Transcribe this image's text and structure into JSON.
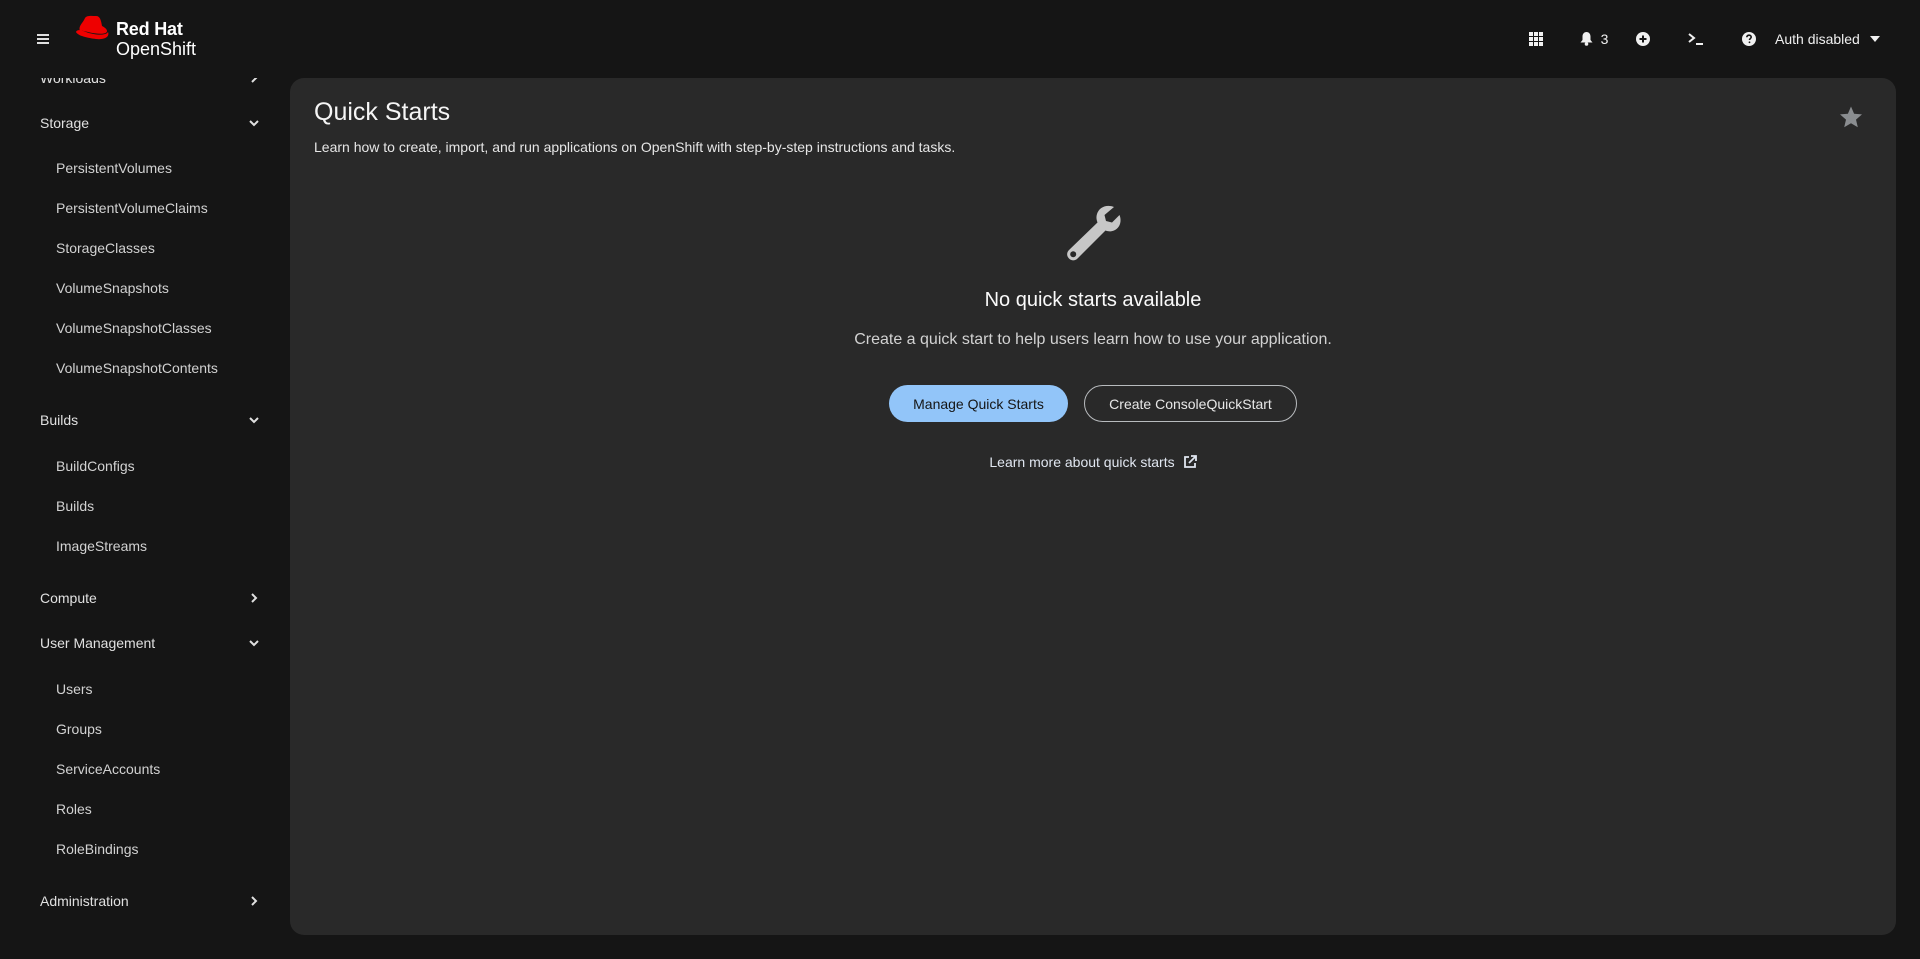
{
  "masthead": {
    "brand_line1": "Red Hat",
    "brand_line2": "OpenShift",
    "notification_count": "3",
    "user_label": "Auth disabled",
    "icons": [
      "menu-icon",
      "apps-grid-icon",
      "bell-icon",
      "plus-circle-icon",
      "terminal-icon",
      "help-icon",
      "caret-down-icon"
    ]
  },
  "sidebar": {
    "partial_top": "Workloads",
    "sections": [
      {
        "label": "Storage",
        "expanded": true,
        "items": [
          "PersistentVolumes",
          "PersistentVolumeClaims",
          "StorageClasses",
          "VolumeSnapshots",
          "VolumeSnapshotClasses",
          "VolumeSnapshotContents"
        ]
      },
      {
        "label": "Builds",
        "expanded": true,
        "items": [
          "BuildConfigs",
          "Builds",
          "ImageStreams"
        ]
      },
      {
        "label": "Compute",
        "expanded": false,
        "items": []
      },
      {
        "label": "User Management",
        "expanded": true,
        "items": [
          "Users",
          "Groups",
          "ServiceAccounts",
          "Roles",
          "RoleBindings"
        ]
      },
      {
        "label": "Administration",
        "expanded": false,
        "items": []
      }
    ]
  },
  "main": {
    "title": "Quick Starts",
    "description": "Learn how to create, import, and run applications on OpenShift with step-by-step instructions and tasks.",
    "empty_state": {
      "icon": "wrench-icon",
      "title": "No quick starts available",
      "body": "Create a quick start to help users learn how to use your application.",
      "primary_button": "Manage Quick Starts",
      "secondary_button": "Create ConsoleQuickStart",
      "link": "Learn more about quick starts"
    }
  },
  "colors": {
    "background": "#151515",
    "card": "#292929",
    "primary_button": "#92c5f9",
    "logo_red": "#ee0000"
  }
}
